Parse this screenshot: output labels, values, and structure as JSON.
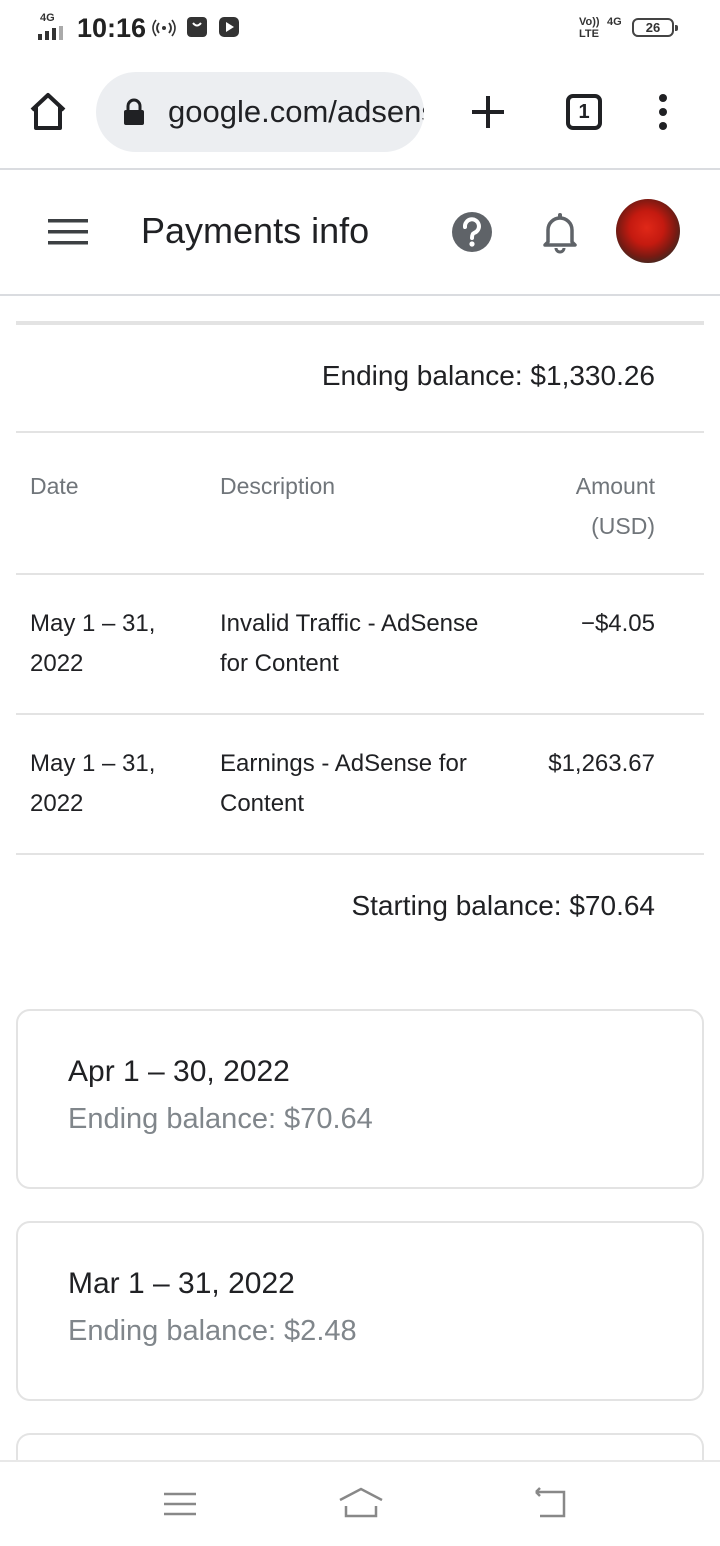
{
  "status_bar": {
    "network": "4G",
    "time": "10:16",
    "volte": "Vo)) LTE",
    "network_right": "4G",
    "battery": "26",
    "icons": [
      "signal-icon",
      "hotspot-icon",
      "shopping-bag-icon",
      "youtube-icon"
    ]
  },
  "browser": {
    "url": "google.com/adsense",
    "tab_count": "1"
  },
  "header": {
    "title": "Payments info"
  },
  "transactions": {
    "ending_balance": "Ending balance: $1,330.26",
    "columns": {
      "date": "Date",
      "description": "Description",
      "amount_line1": "Amount",
      "amount_line2": "(USD)"
    },
    "rows": [
      {
        "date_line1": "May 1 – 31,",
        "date_line2": "2022",
        "desc_line1": "Invalid Traffic - AdSense",
        "desc_line2": "for Content",
        "amount": "−$4.05"
      },
      {
        "date_line1": "May 1 – 31,",
        "date_line2": "2022",
        "desc_line1": "Earnings - AdSense for",
        "desc_line2": "Content",
        "amount": "$1,263.67"
      }
    ],
    "starting_balance": "Starting balance: $70.64"
  },
  "periods": [
    {
      "range": "Apr 1 – 30, 2022",
      "ending": "Ending balance: $70.64"
    },
    {
      "range": "Mar 1 – 31, 2022",
      "ending": "Ending balance: $2.48"
    }
  ],
  "colors": {
    "text": "#202124",
    "secondary_text": "#70757a",
    "divider": "#e3e3e3",
    "url_bar": "#eceef1"
  }
}
